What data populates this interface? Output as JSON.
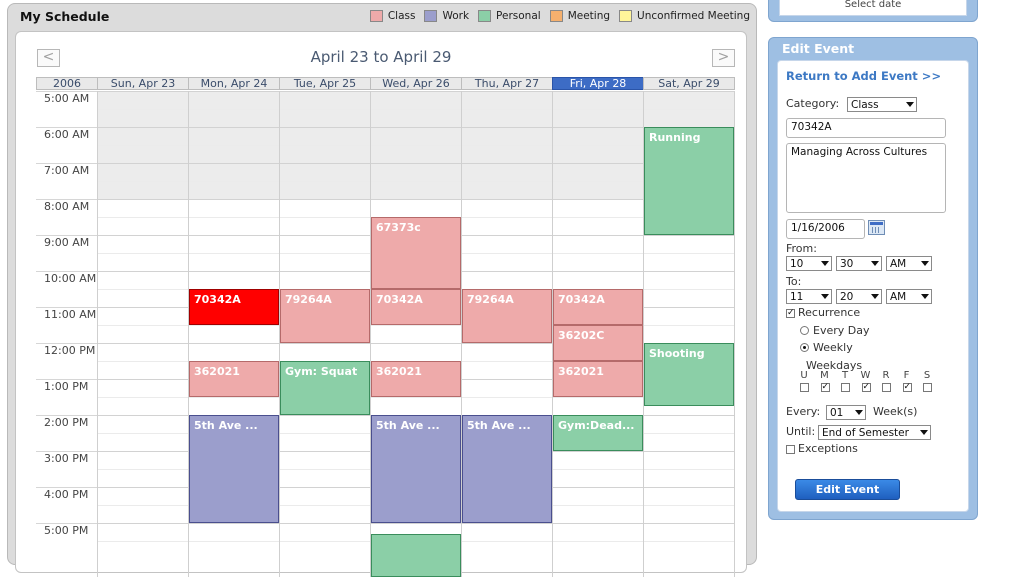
{
  "schedule": {
    "title": "My Schedule",
    "legend": [
      {
        "label": "Class",
        "color": "#eeaaaa"
      },
      {
        "label": "Work",
        "color": "#9b9ecc"
      },
      {
        "label": "Personal",
        "color": "#8bcfa7"
      },
      {
        "label": "Meeting",
        "color": "#f5b06e"
      },
      {
        "label": "Unconfirmed Meeting",
        "color": "#fff59a"
      }
    ],
    "range_title": "April 23 to April 29",
    "prev_label": "<",
    "next_label": ">",
    "year": "2006",
    "days": [
      "Sun, Apr 23",
      "Mon, Apr 24",
      "Tue, Apr 25",
      "Wed, Apr 26",
      "Thu, Apr 27",
      "Fri, Apr 28",
      "Sat, Apr 29"
    ],
    "today_index": 5,
    "hours": [
      "5:00 AM",
      "6:00 AM",
      "7:00 AM",
      "8:00 AM",
      "9:00 AM",
      "10:00 AM",
      "11:00 AM",
      "12:00 PM",
      "1:00 PM",
      "2:00 PM",
      "3:00 PM",
      "4:00 PM",
      "5:00 PM"
    ],
    "events": [
      {
        "day": 6,
        "start": 6.0,
        "end": 9.0,
        "title": "Running",
        "kind": "personal"
      },
      {
        "day": 3,
        "start": 8.5,
        "end": 10.5,
        "title": "67373c",
        "kind": "class"
      },
      {
        "day": 1,
        "start": 10.5,
        "end": 11.5,
        "title": "70342A",
        "kind": "class-selected"
      },
      {
        "day": 2,
        "start": 10.5,
        "end": 12.0,
        "title": "79264A",
        "kind": "class"
      },
      {
        "day": 3,
        "start": 10.5,
        "end": 11.5,
        "title": "70342A",
        "kind": "class"
      },
      {
        "day": 4,
        "start": 10.5,
        "end": 12.0,
        "title": "79264A",
        "kind": "class"
      },
      {
        "day": 5,
        "start": 10.5,
        "end": 11.5,
        "title": "70342A",
        "kind": "class"
      },
      {
        "day": 5,
        "start": 11.5,
        "end": 12.5,
        "title": "36202C",
        "kind": "class"
      },
      {
        "day": 6,
        "start": 12.0,
        "end": 13.75,
        "title": "Shooting",
        "kind": "personal"
      },
      {
        "day": 1,
        "start": 12.5,
        "end": 13.5,
        "title": "362021",
        "kind": "class"
      },
      {
        "day": 2,
        "start": 12.5,
        "end": 14.0,
        "title": "Gym: Squat",
        "kind": "personal"
      },
      {
        "day": 3,
        "start": 12.5,
        "end": 13.5,
        "title": "362021",
        "kind": "class"
      },
      {
        "day": 5,
        "start": 12.5,
        "end": 13.5,
        "title": "362021",
        "kind": "class"
      },
      {
        "day": 1,
        "start": 14.0,
        "end": 17.0,
        "title": "5th Ave ...",
        "kind": "work"
      },
      {
        "day": 3,
        "start": 14.0,
        "end": 17.0,
        "title": "5th Ave ...",
        "kind": "work"
      },
      {
        "day": 4,
        "start": 14.0,
        "end": 17.0,
        "title": "5th Ave ...",
        "kind": "work"
      },
      {
        "day": 5,
        "start": 14.0,
        "end": 15.0,
        "title": "Gym:Dead...",
        "kind": "personal"
      },
      {
        "day": 3,
        "start": 17.3,
        "end": 18.5,
        "title": "",
        "kind": "personal"
      }
    ]
  },
  "date_picker_stub": {
    "label": "Select date"
  },
  "edit": {
    "title": "Edit Event",
    "return_link": "Return to Add Event >>",
    "category_label": "Category:",
    "category_value": "Class",
    "code_value": "70342A",
    "description_value": "Managing Across Cultures",
    "date_value": "1/16/2006",
    "from_label": "From:",
    "from_hour": "10",
    "from_minute": "30",
    "from_ampm": "AM",
    "to_label": "To:",
    "to_hour": "11",
    "to_minute": "20",
    "to_ampm": "AM",
    "recurrence_label": "Recurrence",
    "recurrence_checked": true,
    "every_day_label": "Every Day",
    "weekly_label": "Weekly",
    "weekly_selected": true,
    "weekdays_label": "Weekdays",
    "weekdays": [
      {
        "letter": "U",
        "checked": false
      },
      {
        "letter": "M",
        "checked": true
      },
      {
        "letter": "T",
        "checked": false
      },
      {
        "letter": "W",
        "checked": true
      },
      {
        "letter": "R",
        "checked": false
      },
      {
        "letter": "F",
        "checked": true
      },
      {
        "letter": "S",
        "checked": false
      }
    ],
    "every_label": "Every:",
    "every_value": "01",
    "weeks_label": "Week(s)",
    "until_label": "Until:",
    "until_value": "End of Semester",
    "exceptions_label": "Exceptions",
    "exceptions_checked": false,
    "button_label": "Edit Event"
  }
}
